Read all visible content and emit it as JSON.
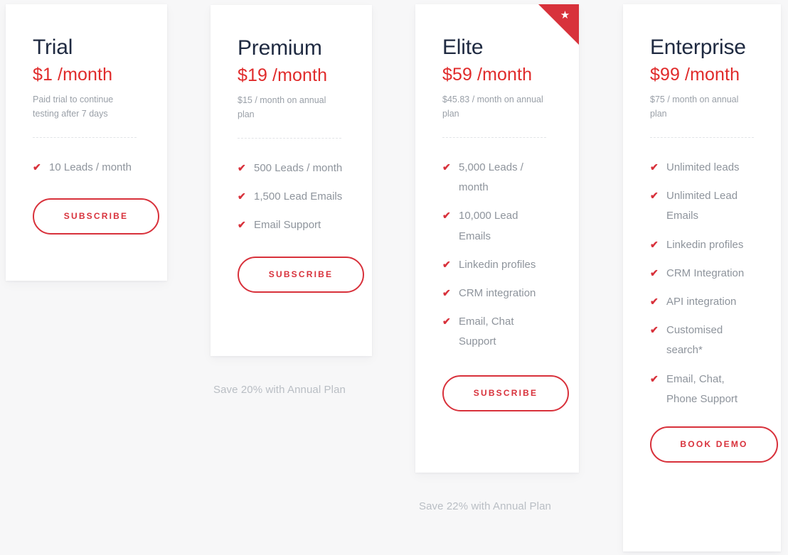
{
  "theme": {
    "accent": "#d8313b",
    "price_color": "#e02b2b",
    "title_color": "#1f2a41",
    "muted_color": "#9aa0a8",
    "feature_color": "#8e949c",
    "save_note_color": "#b9bec4",
    "page_background": "#f7f7f8",
    "card_background": "#ffffff"
  },
  "plans": [
    {
      "id": "trial",
      "title": "Trial",
      "price": "$1 /month",
      "note": "Paid trial to continue testing after 7 days",
      "badge": null,
      "features": [
        "10 Leads / month"
      ],
      "cta_label": "SUBSCRIBE",
      "save_note": null
    },
    {
      "id": "premium",
      "title": "Premium",
      "price": "$19 /month",
      "note": "$15 / month on annual plan",
      "badge": null,
      "features": [
        "500 Leads / month",
        "1,500 Lead Emails",
        "Email Support"
      ],
      "cta_label": "SUBSCRIBE",
      "save_note": "Save 20% with Annual Plan"
    },
    {
      "id": "elite",
      "title": "Elite",
      "price": "$59 /month",
      "note": "$45.83 / month on annual plan",
      "badge": {
        "icon": "star-icon",
        "glyph": "★",
        "color": "#d8323b"
      },
      "features": [
        "5,000 Leads / month",
        "10,000 Lead Emails",
        "Linkedin profiles",
        "CRM integration",
        "Email, Chat Support"
      ],
      "cta_label": "SUBSCRIBE",
      "save_note": "Save 22% with Annual Plan"
    },
    {
      "id": "enterprise",
      "title": "Enterprise",
      "price": "$99 /month",
      "note": "$75 / month on annual plan",
      "badge": null,
      "features": [
        "Unlimited leads",
        "Unlimited Lead Emails",
        "Linkedin profiles",
        "CRM Integration",
        "API integration",
        "Customised search*",
        "Email, Chat, Phone Support"
      ],
      "cta_label": "BOOK DEMO",
      "save_note": null
    }
  ],
  "icons": {
    "check": "✔",
    "star": "★"
  },
  "save_notes": {
    "premium": "Save 20% with Annual Plan",
    "elite": "Save 22% with Annual Plan"
  }
}
